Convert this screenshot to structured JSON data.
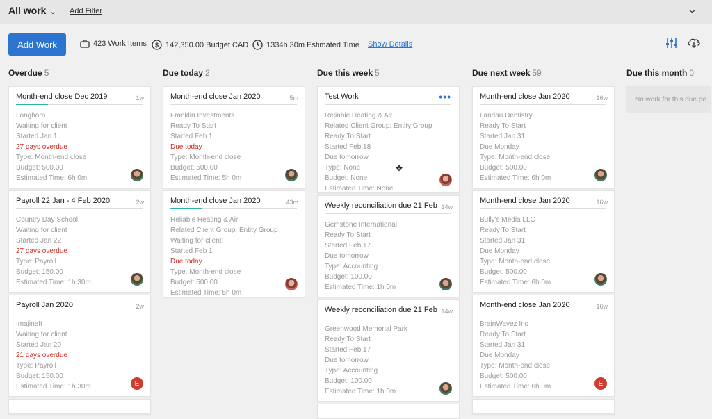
{
  "topbar": {
    "view_label": "All work",
    "add_filter": "Add Filter"
  },
  "toolbar": {
    "add_work": "Add Work",
    "work_items": "423 Work Items",
    "budget": "142,350.00 Budget CAD",
    "estimated": "1334h 30m Estimated Time",
    "show_details": "Show Details"
  },
  "colors": {
    "accent": "#2d74d0",
    "progress": "#2bb3a4",
    "overdue": "#cf2d22"
  },
  "columns": [
    {
      "title": "Overdue",
      "count": "5",
      "cards": [
        {
          "title": "Month-end close Dec 2019",
          "age": "1w",
          "progress": 0.25,
          "lines": [
            "Longhorn",
            "Waiting for client",
            "Started Jan 1",
            "27 days overdue",
            "Type: Month-end close",
            "Budget: 500.00",
            "Estimated Time: 6h 0m"
          ],
          "red": 3,
          "avatar": "photo"
        },
        {
          "title": "Payroll 22 Jan - 4 Feb 2020",
          "age": "2w",
          "progress": 0,
          "lines": [
            "Country Day School",
            "Waiting for client",
            "Started Jan 22",
            "27 days overdue",
            "Type: Payroll",
            "Budget: 150.00",
            "Estimated Time: 1h 30m"
          ],
          "red": 3,
          "avatar": "photo"
        },
        {
          "title": "Payroll Jan 2020",
          "age": "2w",
          "progress": 0,
          "lines": [
            "ImajineIt",
            "Waiting for client",
            "Started Jan 20",
            "21 days overdue",
            "Type: Payroll",
            "Budget: 150.00",
            "Estimated Time: 1h 30m"
          ],
          "red": 3,
          "avatar": "E"
        }
      ]
    },
    {
      "title": "Due today",
      "count": "2",
      "cards": [
        {
          "title": "Month-end close Jan 2020",
          "age": "5m",
          "progress": 0,
          "lines": [
            "Franklin Investments",
            "Ready To Start",
            "Started Feb 1",
            "Due today",
            "Type: Month-end close",
            "Budget: 500.00",
            "Estimated Time: 5h 0m"
          ],
          "red": 3,
          "avatar": "photo"
        },
        {
          "title": "Month-end close Jan 2020",
          "age": "43m",
          "progress": 0.25,
          "lines": [
            "Reliable Heating & Air",
            "Related Client Group: Entity Group",
            "Waiting for client",
            "Started Feb 1",
            "Due today",
            "Type: Month-end close",
            "Budget: 500.00",
            "Estimated Time: 5h 0m"
          ],
          "red": 4,
          "avatar": "photo2"
        }
      ]
    },
    {
      "title": "Due this week",
      "count": "5",
      "cards": [
        {
          "title": "Test Work",
          "age": "",
          "progress": 0,
          "more": "•••",
          "lines": [
            "Reliable Heating & Air",
            "Related Client Group: Entity Group",
            "Ready To Start",
            "Started Feb 18",
            "Due tomorrow",
            "Type: None",
            "Budget: None",
            "Estimated Time: None"
          ],
          "red": -1,
          "avatar": "photo2"
        },
        {
          "title": "Weekly reconciliation due 21 Feb",
          "age": "14w",
          "progress": 0,
          "lines": [
            "Gemstone International",
            "Ready To Start",
            "Started Feb 17",
            "Due tomorrow",
            "Type: Accounting",
            "Budget: 100.00",
            "Estimated Time: 1h 0m"
          ],
          "red": -1,
          "avatar": "photo"
        },
        {
          "title": "Weekly reconciliation due 21 Feb",
          "age": "14w",
          "progress": 0,
          "lines": [
            "Greenwood Memorial Park",
            "Ready To Start",
            "Started Feb 17",
            "Due tomorrow",
            "Type: Accounting",
            "Budget: 100.00",
            "Estimated Time: 1h 0m"
          ],
          "red": -1,
          "avatar": "photo"
        }
      ]
    },
    {
      "title": "Due next week",
      "count": "59",
      "cards": [
        {
          "title": "Month-end close Jan 2020",
          "age": "16w",
          "progress": 0,
          "lines": [
            "Landau Dentistry",
            "Ready To Start",
            "Started Jan 31",
            "Due Monday",
            "Type: Month-end close",
            "Budget: 500.00",
            "Estimated Time: 6h 0m"
          ],
          "red": -1,
          "avatar": "photo"
        },
        {
          "title": "Month-end close Jan 2020",
          "age": "16w",
          "progress": 0,
          "lines": [
            "Bully's Media LLC",
            "Ready To Start",
            "Started Jan 31",
            "Due Monday",
            "Type: Month-end close",
            "Budget: 500.00",
            "Estimated Time: 6h 0m"
          ],
          "red": -1,
          "avatar": "photo"
        },
        {
          "title": "Month-end close Jan 2020",
          "age": "16w",
          "progress": 0,
          "lines": [
            "BrainWavez Inc",
            "Ready To Start",
            "Started Jan 31",
            "Due Monday",
            "Type: Month-end close",
            "Budget: 500.00",
            "Estimated Time: 6h 0m"
          ],
          "red": -1,
          "avatar": "E"
        }
      ]
    },
    {
      "title": "Due this month",
      "count": "0",
      "empty": "No work for this due pe"
    }
  ]
}
